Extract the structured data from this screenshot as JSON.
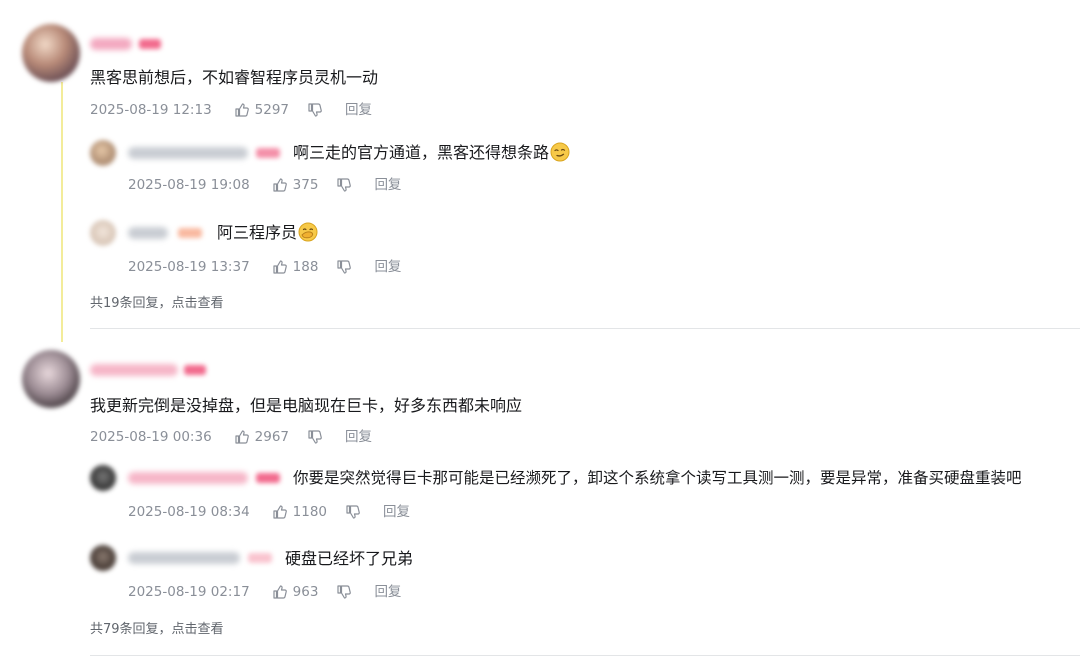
{
  "comments": [
    {
      "text": "黑客思前想后，不如睿智程序员灵机一动",
      "date": "2025-08-19 12:13",
      "likes": "5297",
      "reply_label": "回复",
      "replies": [
        {
          "text": "啊三走的官方通道，黑客还得想条路",
          "date": "2025-08-19 19:08",
          "likes": "375",
          "reply_label": "回复"
        },
        {
          "text": "阿三程序员",
          "date": "2025-08-19 13:37",
          "likes": "188",
          "reply_label": "回复"
        }
      ],
      "more": "共19条回复，点击查看"
    },
    {
      "text": "我更新完倒是没掉盘，但是电脑现在巨卡，好多东西都未响应",
      "date": "2025-08-19 00:36",
      "likes": "2967",
      "reply_label": "回复",
      "replies": [
        {
          "text": "你要是突然觉得巨卡那可能是已经濒死了，卸这个系统拿个读写工具测一测，要是异常，准备买硬盘重装吧",
          "date": "2025-08-19 08:34",
          "likes": "1180",
          "reply_label": "回复"
        },
        {
          "text": "硬盘已经坏了兄弟",
          "date": "2025-08-19 02:17",
          "likes": "963",
          "reply_label": "回复"
        }
      ],
      "more": "共79条回复，点击查看"
    }
  ],
  "icons": {
    "like": "thumbs-up-icon",
    "dislike": "thumbs-down-icon",
    "emoji_1": "smirk-emoji",
    "emoji_2": "hand-over-mouth-emoji"
  },
  "colors": {
    "meta": "#8a8f98",
    "thread_line": "#f3ec9a",
    "name_blur_pink": "#f6b6c8"
  }
}
